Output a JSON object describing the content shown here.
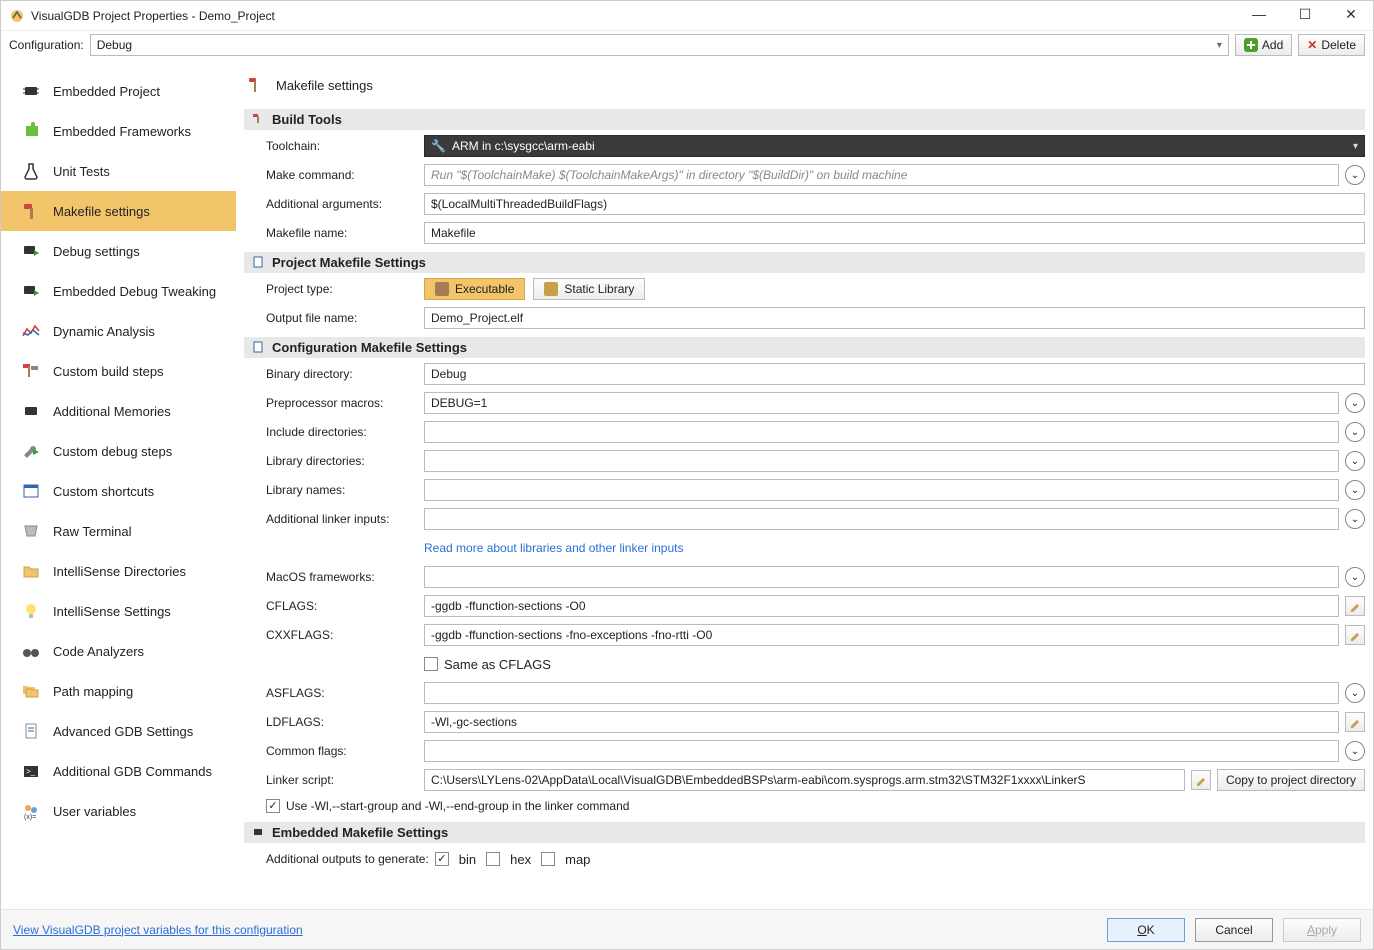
{
  "window": {
    "title": "VisualGDB Project Properties - Demo_Project"
  },
  "cfgbar": {
    "label": "Configuration:",
    "value": "Debug",
    "add": "Add",
    "delete": "Delete"
  },
  "sidebar": {
    "items": [
      {
        "label": "Embedded Project",
        "icon": "chip"
      },
      {
        "label": "Embedded Frameworks",
        "icon": "puzzle"
      },
      {
        "label": "Unit Tests",
        "icon": "flask"
      },
      {
        "label": "Makefile settings",
        "icon": "hammer"
      },
      {
        "label": "Debug settings",
        "icon": "chip-play"
      },
      {
        "label": "Embedded Debug Tweaking",
        "icon": "chip-play2"
      },
      {
        "label": "Dynamic Analysis",
        "icon": "graph"
      },
      {
        "label": "Custom build steps",
        "icon": "hammers"
      },
      {
        "label": "Additional Memories",
        "icon": "chip"
      },
      {
        "label": "Custom debug steps",
        "icon": "wrench-play"
      },
      {
        "label": "Custom shortcuts",
        "icon": "window"
      },
      {
        "label": "Raw Terminal",
        "icon": "serial"
      },
      {
        "label": "IntelliSense Directories",
        "icon": "folder"
      },
      {
        "label": "IntelliSense Settings",
        "icon": "bulb"
      },
      {
        "label": "Code Analyzers",
        "icon": "binocular"
      },
      {
        "label": "Path mapping",
        "icon": "folders"
      },
      {
        "label": "Advanced GDB Settings",
        "icon": "doc"
      },
      {
        "label": "Additional GDB Commands",
        "icon": "terminal"
      },
      {
        "label": "User variables",
        "icon": "users"
      }
    ],
    "active_index": 3
  },
  "page": {
    "title": "Makefile settings",
    "sections": {
      "build_tools": {
        "title": "Build Tools",
        "toolchain_label": "Toolchain:",
        "toolchain_value": "ARM in c:\\sysgcc\\arm-eabi",
        "make_cmd_label": "Make command:",
        "make_cmd_placeholder": "Run \"$(ToolchainMake) $(ToolchainMakeArgs)\" in directory \"$(BuildDir)\" on build machine",
        "addl_args_label": "Additional arguments:",
        "addl_args_value": "$(LocalMultiThreadedBuildFlags)",
        "makefile_name_label": "Makefile name:",
        "makefile_name_value": "Makefile"
      },
      "project_make": {
        "title": "Project Makefile Settings",
        "project_type_label": "Project type:",
        "exe": "Executable",
        "static": "Static Library",
        "output_file_label": "Output file name:",
        "output_file_value": "Demo_Project.elf"
      },
      "config_make": {
        "title": "Configuration Makefile Settings",
        "bindir_label": "Binary directory:",
        "bindir_value": "Debug",
        "preproc_label": "Preprocessor macros:",
        "preproc_value": "DEBUG=1",
        "incl_label": "Include directories:",
        "libdir_label": "Library directories:",
        "libnames_label": "Library names:",
        "addlinker_label": "Additional linker inputs:",
        "link_text": "Read more about libraries and other linker inputs",
        "macos_label": "MacOS frameworks:",
        "cflags_label": "CFLAGS:",
        "cflags_value": "-ggdb -ffunction-sections -O0",
        "cxxflags_label": "CXXFLAGS:",
        "cxxflags_value": "-ggdb -ffunction-sections -fno-exceptions -fno-rtti -O0",
        "same_as_cflags": "Same as CFLAGS",
        "asflags_label": "ASFLAGS:",
        "ldflags_label": "LDFLAGS:",
        "ldflags_value": "-Wl,-gc-sections",
        "common_label": "Common flags:",
        "linker_label": "Linker script:",
        "linker_value": "C:\\Users\\LYLens-02\\AppData\\Local\\VisualGDB\\EmbeddedBSPs\\arm-eabi\\com.sysprogs.arm.stm32\\STM32F1xxxx\\LinkerS",
        "copy_btn": "Copy to project directory",
        "use_wl": "Use -Wl,--start-group and -Wl,--end-group in the linker command"
      },
      "embedded_make": {
        "title": "Embedded Makefile Settings",
        "addl_outputs_label": "Additional outputs to generate:",
        "bin": "bin",
        "hex": "hex",
        "map": "map"
      }
    }
  },
  "footer": {
    "link": "View VisualGDB project variables for this configuration",
    "ok": "OK",
    "cancel": "Cancel",
    "apply": "Apply"
  }
}
